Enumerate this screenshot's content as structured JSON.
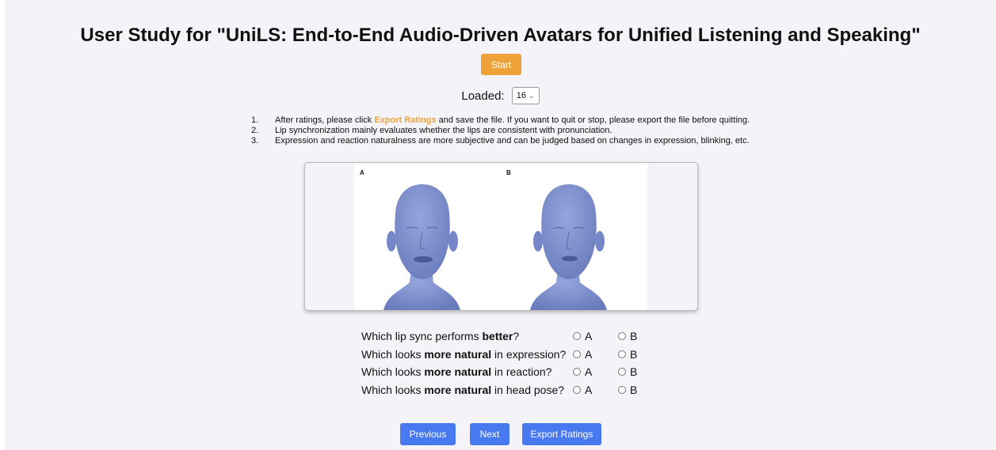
{
  "page": {
    "title": "User Study for \"UniLS: End-to-End Audio-Driven Avatars for Unified Listening and Speaking\""
  },
  "controls": {
    "start_label": "Start",
    "loaded_label": "Loaded:",
    "loaded_value": "16"
  },
  "instructions": [
    {
      "num": "1.",
      "before": "After ratings, please click ",
      "highlight": "Export Ratings",
      "after": " and save the file. If you want to quit or stop, please export the file before quitting."
    },
    {
      "num": "2.",
      "text": "Lip synchronization mainly evaluates whether the lips are consistent with pronunciation."
    },
    {
      "num": "3.",
      "text": "Expression and reaction naturalness are more subjective and can be judged based on changes in expression, blinking, etc."
    }
  ],
  "video": {
    "label_a": "A",
    "label_b": "B"
  },
  "questions": [
    {
      "prefix": "Which lip sync performs ",
      "bold": "better",
      "suffix": "?"
    },
    {
      "prefix": "Which looks ",
      "bold": "more natural",
      "suffix": " in expression?"
    },
    {
      "prefix": "Which looks ",
      "bold": "more natural",
      "suffix": " in reaction?"
    },
    {
      "prefix": "Which looks ",
      "bold": "more natural",
      "suffix": " in head pose?"
    }
  ],
  "options": {
    "a": "A",
    "b": "B"
  },
  "nav": {
    "previous_label": "Previous",
    "next_label": "Next",
    "export_label": "Export Ratings"
  },
  "colors": {
    "accent_orange": "#f0a23a",
    "button_blue": "#4979f0",
    "avatar_blue": "#7d8fcb"
  }
}
